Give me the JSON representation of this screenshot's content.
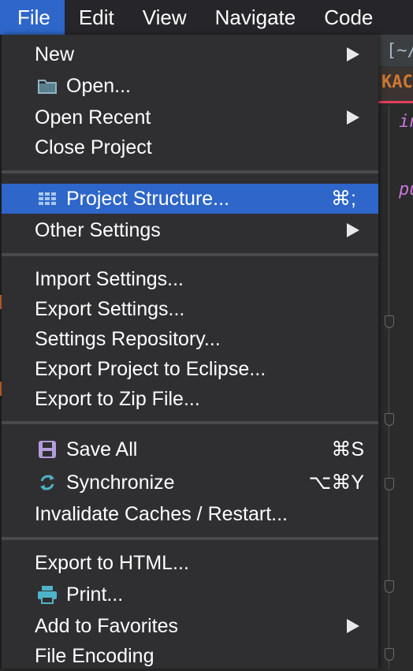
{
  "menubar": {
    "items": [
      "File",
      "Edit",
      "View",
      "Navigate",
      "Code"
    ]
  },
  "editor": {
    "tab_text": "[~/",
    "file_tab_text": "KAC",
    "code_lines": [
      "in",
      "pu"
    ]
  },
  "menu": {
    "new": "New",
    "open": "Open...",
    "open_recent": "Open Recent",
    "close_project": "Close Project",
    "project_structure": "Project Structure...",
    "project_structure_shortcut": "⌘;",
    "other_settings": "Other Settings",
    "import_settings": "Import Settings...",
    "export_settings": "Export Settings...",
    "settings_repository": "Settings Repository...",
    "export_eclipse": "Export Project to Eclipse...",
    "export_zip": "Export to Zip File...",
    "save_all": "Save All",
    "save_all_shortcut": "⌘S",
    "synchronize": "Synchronize",
    "synchronize_shortcut": "⌥⌘Y",
    "invalidate_caches": "Invalidate Caches / Restart...",
    "export_html": "Export to HTML...",
    "print": "Print...",
    "add_favorites": "Add to Favorites",
    "file_encoding": "File Encoding"
  },
  "icons": {
    "open": "folder-icon",
    "project_structure": "grid-icon",
    "save_all": "floppy-disk-icon",
    "synchronize": "sync-icon",
    "print": "printer-icon",
    "submenu": "submenu-arrow-icon"
  },
  "colors": {
    "highlight": "#2e66c9",
    "menu_bg": "#2f2f31",
    "menubar_bg": "#26262a"
  }
}
